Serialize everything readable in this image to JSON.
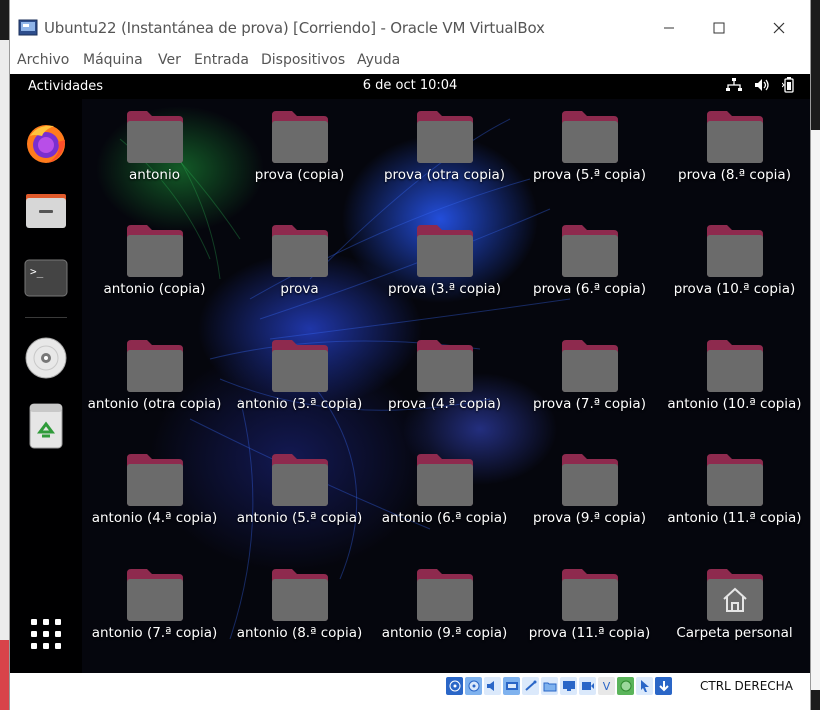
{
  "window": {
    "title": "Ubuntu22 (Instantánea de prova) [Corriendo] - Oracle VM VirtualBox",
    "menu": [
      "Archivo",
      "Máquina",
      "Ver",
      "Entrada",
      "Dispositivos",
      "Ayuda"
    ]
  },
  "topbar": {
    "activities": "Actividades",
    "clock": "6 de oct  10:04"
  },
  "dock": {
    "items": [
      "firefox-icon",
      "files-icon",
      "terminal-icon",
      "disc-icon",
      "trash-icon",
      "show-apps-icon"
    ]
  },
  "desktop": {
    "items": [
      {
        "label": "antonio"
      },
      {
        "label": "prova (copia)"
      },
      {
        "label": "prova (otra copia)"
      },
      {
        "label": "prova (5.ª copia)"
      },
      {
        "label": "prova (8.ª copia)"
      },
      {
        "label": "antonio (copia)"
      },
      {
        "label": "prova"
      },
      {
        "label": "prova (3.ª copia)"
      },
      {
        "label": "prova (6.ª copia)"
      },
      {
        "label": "prova (10.ª copia)"
      },
      {
        "label": "antonio (otra copia)"
      },
      {
        "label": "antonio (3.ª copia)"
      },
      {
        "label": "prova (4.ª copia)"
      },
      {
        "label": "prova (7.ª copia)"
      },
      {
        "label": "antonio (10.ª copia)"
      },
      {
        "label": "antonio (4.ª copia)"
      },
      {
        "label": "antonio (5.ª copia)"
      },
      {
        "label": "antonio (6.ª copia)"
      },
      {
        "label": "prova (9.ª copia)"
      },
      {
        "label": "antonio (11.ª copia)"
      },
      {
        "label": "antonio (7.ª copia)"
      },
      {
        "label": "antonio (8.ª copia)"
      },
      {
        "label": "antonio (9.ª copia)"
      },
      {
        "label": "prova (11.ª copia)"
      },
      {
        "label": "Carpeta personal"
      }
    ]
  },
  "statusbar": {
    "host_key": "CTRL DERECHA"
  },
  "colors": {
    "folder_top": "#8e2a4e",
    "folder_body": "#6b6b6b",
    "dock_bg": "#0c0c0c"
  }
}
